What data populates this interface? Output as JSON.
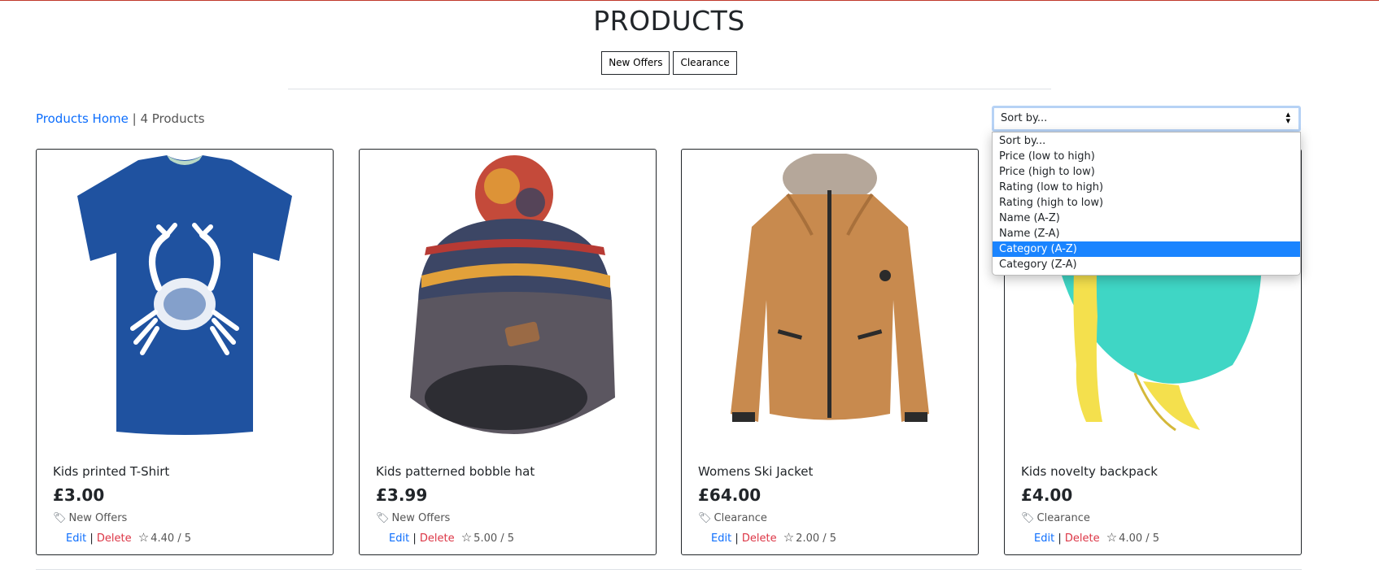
{
  "header": {
    "title": "PRODUCTS",
    "filters": [
      "New Offers",
      "Clearance"
    ]
  },
  "breadcrumb": {
    "link": "Products Home",
    "separator": " | ",
    "count": "4 Products"
  },
  "sort": {
    "current": "Sort by...",
    "options": [
      "Sort by...",
      "Price (low to high)",
      "Price (high to low)",
      "Rating (low to high)",
      "Rating (high to low)",
      "Name (A-Z)",
      "Name (Z-A)",
      "Category (A-Z)",
      "Category (Z-A)"
    ],
    "highlighted": "Category (A-Z)"
  },
  "products": [
    {
      "name": "Kids printed T-Shirt",
      "price": "£3.00",
      "category": "New Offers",
      "edit": "Edit",
      "delete": "Delete",
      "rating": "4.40 / 5",
      "image": "tshirt"
    },
    {
      "name": "Kids patterned bobble hat",
      "price": "£3.99",
      "category": "New Offers",
      "edit": "Edit",
      "delete": "Delete",
      "rating": "5.00 / 5",
      "image": "hat"
    },
    {
      "name": "Womens Ski Jacket",
      "price": "£64.00",
      "category": "Clearance",
      "edit": "Edit",
      "delete": "Delete",
      "rating": "2.00 / 5",
      "image": "jacket"
    },
    {
      "name": "Kids novelty backpack",
      "price": "£4.00",
      "category": "Clearance",
      "edit": "Edit",
      "delete": "Delete",
      "rating": "4.00 / 5",
      "image": "backpack"
    }
  ],
  "colors": {
    "link": "#0d6efd",
    "delete": "#dc3545",
    "highlight": "#1a84ff",
    "top_rule": "#c0392b"
  }
}
